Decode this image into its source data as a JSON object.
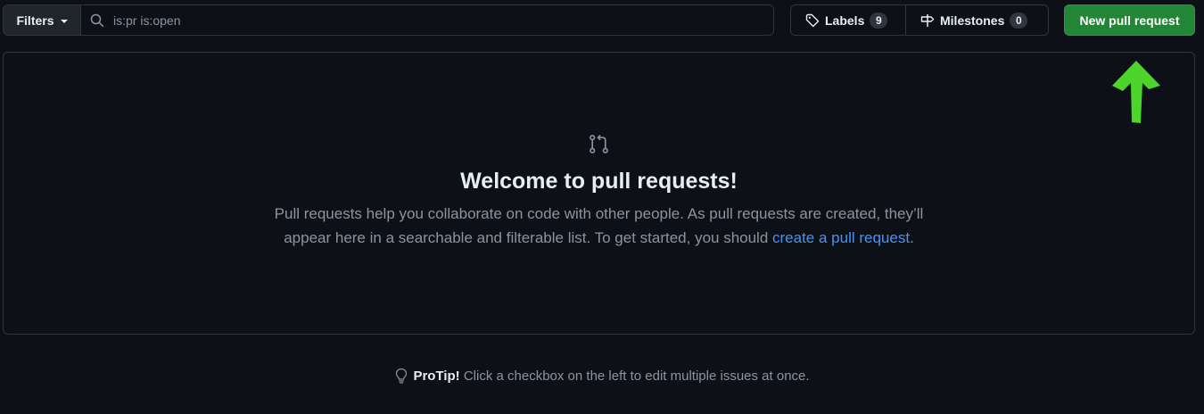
{
  "toolbar": {
    "filters_label": "Filters",
    "search_value": "is:pr is:open",
    "labels_label": "Labels",
    "labels_count": "9",
    "milestones_label": "Milestones",
    "milestones_count": "0",
    "new_pr_label": "New pull request"
  },
  "blankslate": {
    "heading": "Welcome to pull requests!",
    "body_line1": "Pull requests help you collaborate on code with other people. As pull requests are created, they’ll",
    "body_line2_prefix": "appear here in a searchable and filterable list. To get started, you should ",
    "body_link": "create a pull request",
    "body_line2_suffix": "."
  },
  "protip": {
    "bold": "ProTip!",
    "text": " Click a checkbox on the left to edit multiple issues at once."
  },
  "icons": {
    "search": "search-icon",
    "tag": "tag-icon",
    "milestone": "milestone-icon",
    "pull_request": "git-pull-request-icon",
    "bulb": "light-bulb-icon",
    "annotation_arrow": "arrow-up-icon"
  },
  "colors": {
    "background": "#0d1117",
    "border": "#30363d",
    "primary_button": "#238636",
    "link": "#4493f8",
    "muted_text": "#8b949e",
    "annotation_arrow": "#4cd62b"
  }
}
